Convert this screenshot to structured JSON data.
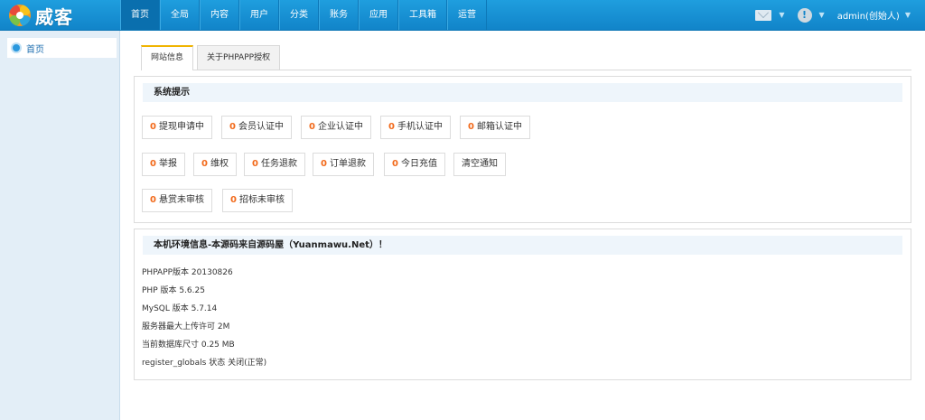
{
  "brand": {
    "name": "威客"
  },
  "nav": [
    "首页",
    "全局",
    "内容",
    "用户",
    "分类",
    "账务",
    "应用",
    "工具箱",
    "运营"
  ],
  "user": {
    "name": "admin(创始人)"
  },
  "sidebar": {
    "items": [
      {
        "label": "首页"
      }
    ]
  },
  "tabs": [
    "网站信息",
    "关于PHPAPP授权"
  ],
  "system_tips": {
    "title": "系统提示",
    "rows": [
      [
        {
          "count": "0",
          "label": "提现申请中"
        },
        {
          "count": "0",
          "label": "会员认证中"
        },
        {
          "count": "0",
          "label": "企业认证中"
        },
        {
          "count": "0",
          "label": "手机认证中"
        },
        {
          "count": "0",
          "label": "邮箱认证中"
        }
      ],
      [
        {
          "count": "0",
          "label": "举报"
        },
        {
          "count": "0",
          "label": "维权"
        },
        {
          "count": "0",
          "label": "任务退款"
        },
        {
          "count": "0",
          "label": "订单退款"
        },
        {
          "count": "0",
          "label": "今日充值"
        },
        {
          "count": "",
          "label": "清空通知"
        }
      ],
      [
        {
          "count": "0",
          "label": "悬赏未审核"
        },
        {
          "count": "0",
          "label": "招标未审核"
        }
      ]
    ]
  },
  "env": {
    "title": "本机环境信息-本源码来自源码屋（Yuanmawu.Net）！",
    "lines": [
      "PHPAPP版本 20130826",
      "PHP 版本 5.6.25",
      "MySQL 版本 5.7.14",
      "服务器最大上传许可 2M",
      "当前数据库尺寸 0.25 MB",
      "register_globals 状态 关闭(正常)"
    ]
  },
  "colors": {
    "topbar": "#1184c9",
    "accent_count": "#f26a1b",
    "sidebar_bg": "#e3eef7",
    "tab_active_border": "#f0b400"
  }
}
